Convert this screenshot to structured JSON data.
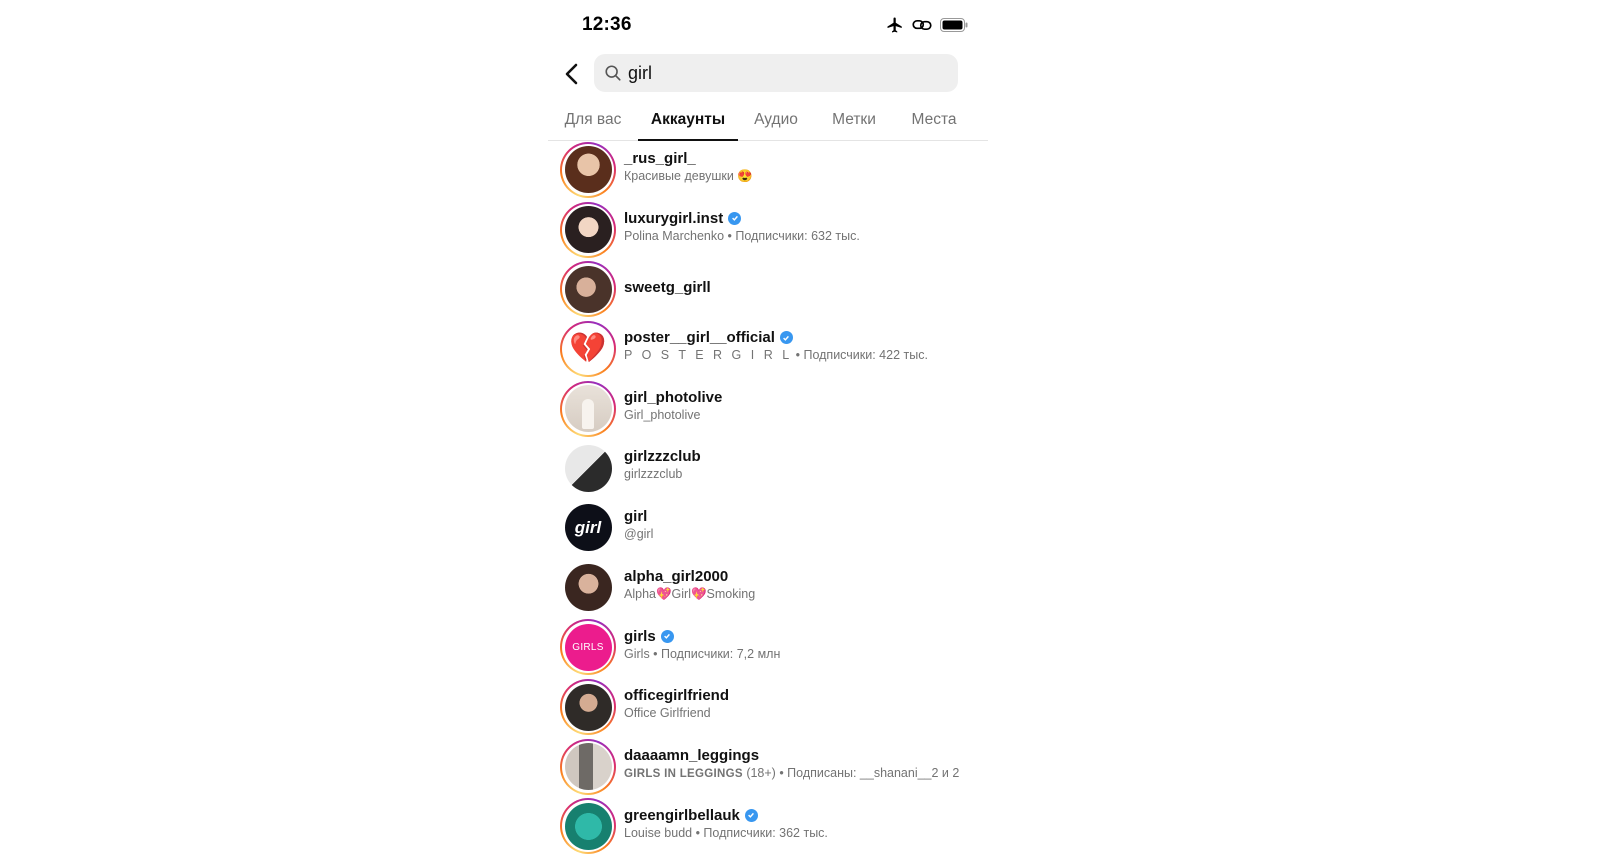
{
  "status_bar": {
    "time": "12:36"
  },
  "search": {
    "query": "girl"
  },
  "tabs": [
    {
      "label": "Для вас",
      "active": false
    },
    {
      "label": "Аккаунты",
      "active": true
    },
    {
      "label": "Аудио",
      "active": false
    },
    {
      "label": "Метки",
      "active": false
    },
    {
      "label": "Места",
      "active": false
    }
  ],
  "accounts": [
    {
      "username": "_rus_girl_",
      "subtitle": "Красивые девушки 😍",
      "verified": false,
      "story_ring": true
    },
    {
      "username": "luxurygirl.inst",
      "subtitle": "Polina Marchenko • Подписчики: 632 тыс.",
      "verified": true,
      "story_ring": true
    },
    {
      "username": "sweetg_girll",
      "subtitle": "",
      "verified": false,
      "story_ring": true
    },
    {
      "username": "poster__girl__official",
      "subtitle_spaced": "P O S T E R  G I R L",
      "subtitle_rest": " • Подписчики: 422 тыс.",
      "verified": true,
      "story_ring": true,
      "avatar_glyph": "💔"
    },
    {
      "username": "girl_photolive",
      "subtitle": "Girl_photolive",
      "verified": false,
      "story_ring": true
    },
    {
      "username": "girlzzzclub",
      "subtitle": "girlzzzclub",
      "verified": false,
      "story_ring": false
    },
    {
      "username": "girl",
      "subtitle": "@girl",
      "verified": false,
      "story_ring": false,
      "avatar_text": "girl"
    },
    {
      "username": "alpha_girl2000",
      "subtitle": "Alpha💖Girl💖Smoking",
      "verified": false,
      "story_ring": false
    },
    {
      "username": "girls",
      "subtitle": "Girls • Подписчики: 7,2 млн",
      "verified": true,
      "story_ring": true,
      "avatar_text": "GIRLS"
    },
    {
      "username": "officegirlfriend",
      "subtitle": "Office Girlfriend",
      "verified": false,
      "story_ring": true
    },
    {
      "username": "daaaamn_leggings",
      "subtitle_caps": "GIRLS IN LEGGINGS",
      "subtitle_rest": " (18+) • Подписаны: __shanani__2 и 2",
      "verified": false,
      "story_ring": true
    },
    {
      "username": "greengirlbellauk",
      "subtitle": "Louise budd • Подписчики: 362 тыс.",
      "verified": true,
      "story_ring": true
    }
  ],
  "colors": {
    "verified": "#3897f0",
    "muted_text": "#737373",
    "search_bg": "#efefef",
    "girls_avatar": "#ec1c8d"
  }
}
